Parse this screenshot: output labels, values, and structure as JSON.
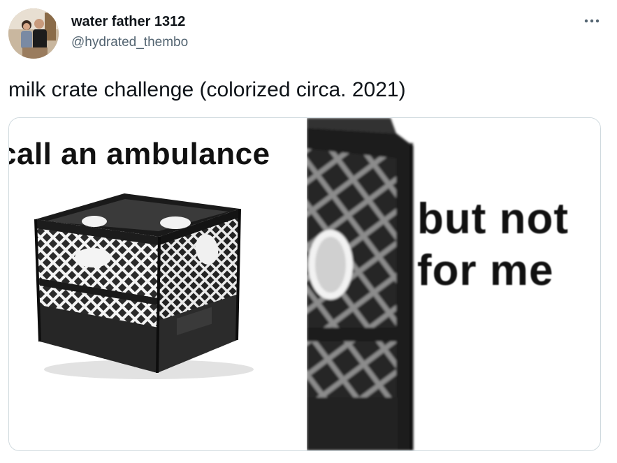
{
  "author": {
    "display_name": "water father 1312",
    "handle": "@hydrated_thembo"
  },
  "tweet": {
    "text": "milk crate challenge (colorized circa. 2021)"
  },
  "media": {
    "left_caption": "call an ambulance",
    "right_caption": "but not\nfor me"
  },
  "icons": {
    "more": "more-options-icon",
    "avatar": "profile-photo"
  }
}
